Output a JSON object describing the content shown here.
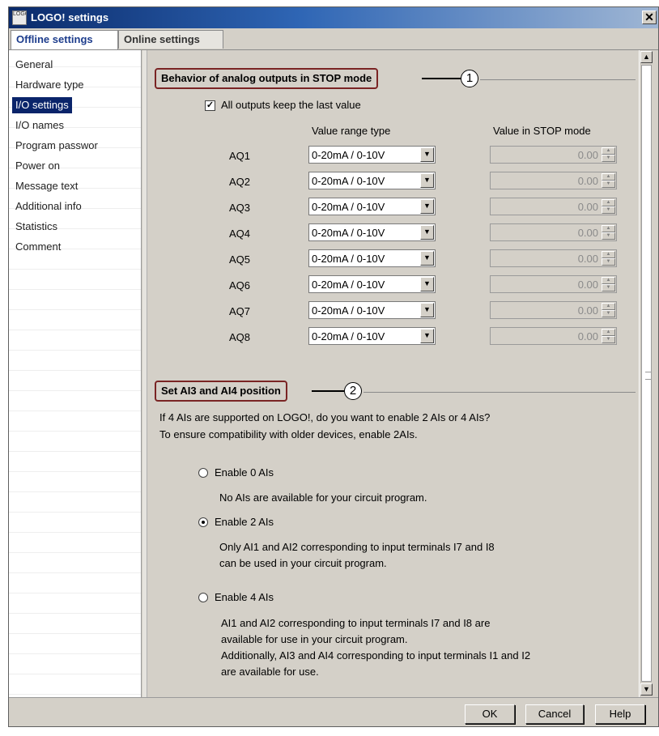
{
  "window": {
    "title": "LOGO! settings",
    "app_icon_text": "LOGO",
    "close_glyph": "✕"
  },
  "tabs": [
    {
      "label": "Offline settings",
      "active": true
    },
    {
      "label": "Online settings",
      "active": false
    }
  ],
  "sidebar": {
    "items": [
      {
        "label": "General",
        "selected": false
      },
      {
        "label": "Hardware type",
        "selected": false
      },
      {
        "label": "I/O settings",
        "selected": true
      },
      {
        "label": "I/O names",
        "selected": false
      },
      {
        "label": "Program passwor",
        "selected": false
      },
      {
        "label": "Power on",
        "selected": false
      },
      {
        "label": "Message text",
        "selected": false
      },
      {
        "label": "Additional info",
        "selected": false
      },
      {
        "label": "Statistics",
        "selected": false
      },
      {
        "label": "Comment",
        "selected": false
      }
    ]
  },
  "analog": {
    "section_title": "Behavior of analog outputs in STOP mode",
    "callout": "1",
    "keep_last_value_label": "All outputs keep the last value",
    "keep_last_value_checked": true,
    "col_range_header": "Value range type",
    "col_stop_header": "Value in STOP mode",
    "rows": [
      {
        "name": "AQ1",
        "range": "0-20mA / 0-10V",
        "stop_value": "0.00"
      },
      {
        "name": "AQ2",
        "range": "0-20mA / 0-10V",
        "stop_value": "0.00"
      },
      {
        "name": "AQ3",
        "range": "0-20mA / 0-10V",
        "stop_value": "0.00"
      },
      {
        "name": "AQ4",
        "range": "0-20mA / 0-10V",
        "stop_value": "0.00"
      },
      {
        "name": "AQ5",
        "range": "0-20mA / 0-10V",
        "stop_value": "0.00"
      },
      {
        "name": "AQ6",
        "range": "0-20mA / 0-10V",
        "stop_value": "0.00"
      },
      {
        "name": "AQ7",
        "range": "0-20mA / 0-10V",
        "stop_value": "0.00"
      },
      {
        "name": "AQ8",
        "range": "0-20mA / 0-10V",
        "stop_value": "0.00"
      }
    ]
  },
  "ai": {
    "section_title": "Set AI3 and AI4 position",
    "callout": "2",
    "intro_line1": "If 4 AIs are supported on LOGO!, do you want to enable 2 AIs or 4 AIs?",
    "intro_line2": "To ensure compatibility with older devices, enable 2AIs.",
    "options": [
      {
        "label": "Enable 0 AIs",
        "checked": false,
        "desc": [
          "No AIs are available for your circuit program."
        ]
      },
      {
        "label": "Enable 2 AIs",
        "checked": true,
        "desc": [
          "Only AI1 and AI2 corresponding to input terminals I7 and I8",
          "can be used in your circuit program."
        ]
      },
      {
        "label": "Enable 4 AIs",
        "checked": false,
        "desc": [
          "AI1 and AI2 corresponding to input terminals I7 and I8 are",
          "available for use in your circuit program.",
          "Additionally, AI3 and AI4 corresponding to input terminals I1 and I2",
          "are available for use."
        ]
      }
    ]
  },
  "buttons": {
    "ok": "OK",
    "cancel": "Cancel",
    "help": "Help"
  },
  "colors": {
    "selection": "#0a246a",
    "section_border": "#7a2424",
    "tab_active_text": "#1c3c8c"
  }
}
